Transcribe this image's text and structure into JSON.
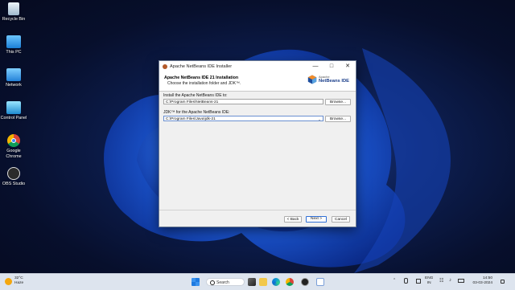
{
  "desktop_icons": [
    {
      "label": "Recycle Bin",
      "icon": "recycle-bin-icon"
    },
    {
      "label": "This PC",
      "icon": "computer-icon"
    },
    {
      "label": "Network",
      "icon": "network-icon"
    },
    {
      "label": "Control Panel",
      "icon": "control-panel-icon"
    },
    {
      "label": "Google Chrome",
      "icon": "chrome-icon"
    },
    {
      "label": "OBS Studio",
      "icon": "obs-icon"
    }
  ],
  "window": {
    "title": "Apache NetBeans IDE Installer",
    "header_title": "Apache NetBeans IDE 21 Installation",
    "header_subtitle": "Choose the installation folder and JDK™.",
    "logo_small": "Apache",
    "logo_big": "NetBeans IDE",
    "install_label": "Install the Apache NetBeans IDE to:",
    "install_path": "C:\\Program Files\\NetBeans-21",
    "browse1": "Browse...",
    "jdk_label": "JDK™ for the Apache NetBeans IDE:",
    "jdk_path": "C:\\Program Files\\Java\\jdk-21",
    "browse2": "Browse...",
    "back": "< Back",
    "next": "Next >",
    "cancel": "Cancel"
  },
  "taskbar": {
    "temp": "32°C",
    "condition": "Haze",
    "search": "Search",
    "lang1": "ENG",
    "lang2": "IN",
    "time": "14:50",
    "date": "03-03-2024"
  }
}
